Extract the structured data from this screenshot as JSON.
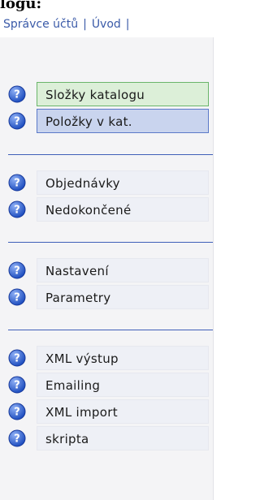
{
  "header": {
    "title": "logu:"
  },
  "topnav": {
    "items": [
      "Správce účtů",
      "Úvod"
    ]
  },
  "menu": {
    "groups": [
      {
        "items": [
          {
            "label": "Složky katalogu",
            "state": "selected-green",
            "icon": "help-icon"
          },
          {
            "label": "Položky v kat.",
            "state": "selected-blue",
            "icon": "help-icon"
          }
        ]
      },
      {
        "items": [
          {
            "label": "Objednávky",
            "icon": "help-icon"
          },
          {
            "label": "Nedokončené",
            "icon": "help-icon"
          }
        ]
      },
      {
        "items": [
          {
            "label": "Nastavení",
            "icon": "help-icon"
          },
          {
            "label": "Parametry",
            "icon": "help-icon"
          }
        ]
      },
      {
        "items": [
          {
            "label": "XML výstup",
            "icon": "help-icon"
          },
          {
            "label": "Emailing",
            "icon": "help-icon"
          },
          {
            "label": "XML import",
            "icon": "help-icon"
          },
          {
            "label": "skripta",
            "icon": "help-icon"
          }
        ]
      }
    ]
  },
  "colors": {
    "accent": "#3f5fb8",
    "selected_green_bg": "#dcefd8",
    "selected_blue_bg": "#c9d4ee",
    "item_bg": "#eef0f6"
  }
}
